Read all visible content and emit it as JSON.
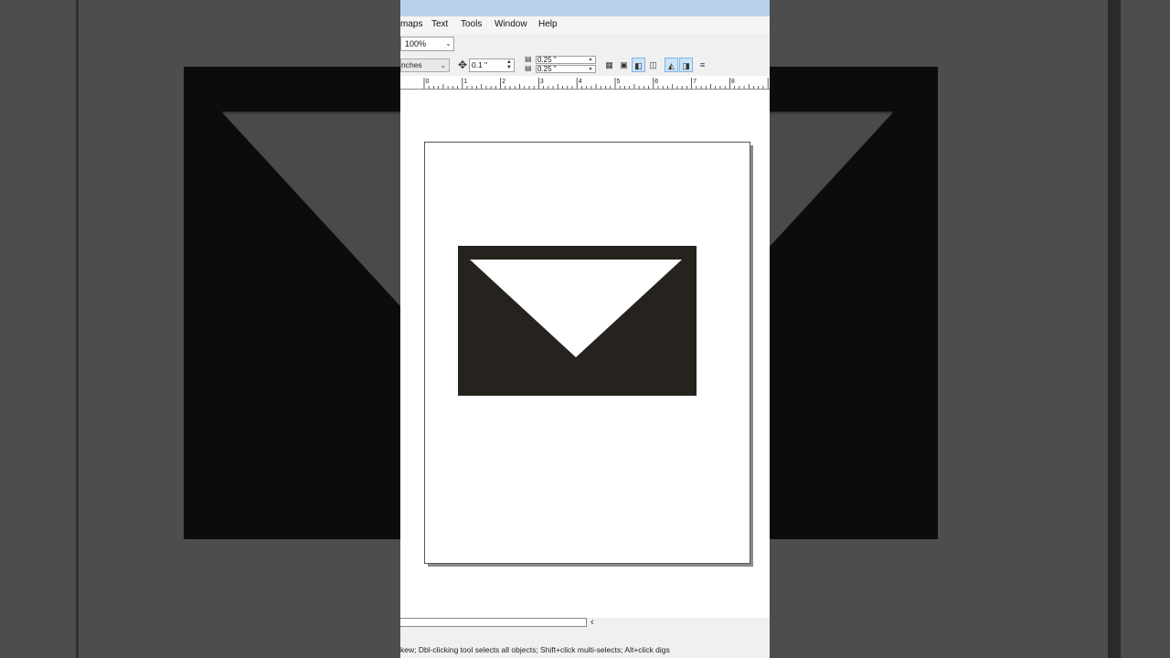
{
  "menu": [
    {
      "label": "maps"
    },
    {
      "label": "Text"
    },
    {
      "label": "Tools"
    },
    {
      "label": "Window"
    },
    {
      "label": "Help"
    }
  ],
  "toolbar": {
    "zoom_value": "100%",
    "units_value": "nches",
    "nudge_value": "0.1 \"",
    "duplicate_x": "0.25 \"",
    "duplicate_y": "0.25 \""
  },
  "ruler": {
    "labels": [
      "0",
      "1",
      "2",
      "3",
      "4",
      "5",
      "6",
      "7",
      "8"
    ]
  },
  "document": {
    "page_color": "#ffffff",
    "envelope_color": "#26221e"
  },
  "icons": {
    "nudge": "move-arrows-icon",
    "duplicate_x": "duplicate-x-icon",
    "duplicate_y": "duplicate-y-icon"
  },
  "status": {
    "text": "kew; Dbl-clicking tool selects all objects; Shift+click multi-selects; Alt+click digs"
  }
}
